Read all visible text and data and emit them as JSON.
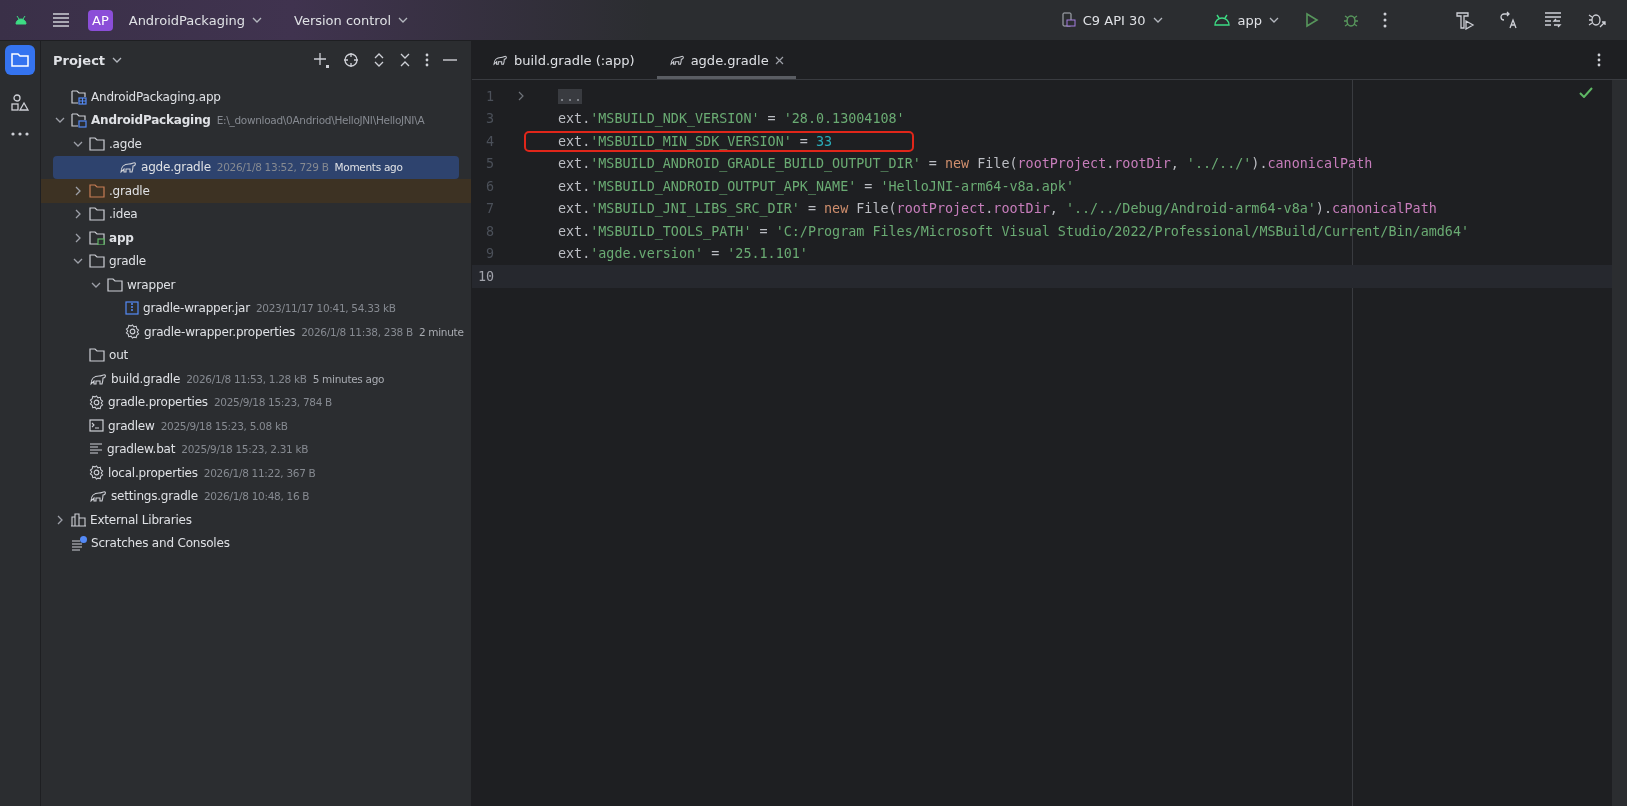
{
  "toolbar": {
    "project_badge": "AP",
    "project_name": "AndroidPackaging",
    "vcs": "Version control",
    "device": "C9 API 30",
    "run_config": "app"
  },
  "project_panel": {
    "title": "Project",
    "tree": [
      {
        "name": "AndroidPackaging.app",
        "kind": "module-app"
      },
      {
        "name": "AndroidPackaging",
        "bold": true,
        "meta": "E:\\_download\\0Andriod\\HelloJNI\\HelloJNI\\A",
        "kind": "module",
        "expanded": true,
        "children": [
          {
            "name": ".agde",
            "kind": "folder",
            "expanded": true,
            "children": [
              {
                "name": "agde.gradle",
                "kind": "gradle",
                "meta": "2026/1/8 13:52, 729 B",
                "note": "Moments ago",
                "selected": true
              }
            ]
          },
          {
            "name": ".gradle",
            "kind": "folder-excluded",
            "expanded": false,
            "highlighted": true
          },
          {
            "name": ".idea",
            "kind": "folder",
            "expanded": false
          },
          {
            "name": "app",
            "kind": "folder-module",
            "bold": true,
            "expanded": false
          },
          {
            "name": "gradle",
            "kind": "folder",
            "expanded": true,
            "children": [
              {
                "name": "wrapper",
                "kind": "folder",
                "expanded": true,
                "children": [
                  {
                    "name": "gradle-wrapper.jar",
                    "kind": "jar",
                    "meta": "2023/11/17 10:41, 54.33 kB"
                  },
                  {
                    "name": "gradle-wrapper.properties",
                    "kind": "settings",
                    "meta": "2026/1/8 11:38, 238 B",
                    "note": "2 minute"
                  }
                ]
              }
            ]
          },
          {
            "name": "out",
            "kind": "folder"
          },
          {
            "name": "build.gradle",
            "kind": "gradle",
            "meta": "2026/1/8 11:53, 1.28 kB",
            "note": "5 minutes ago"
          },
          {
            "name": "gradle.properties",
            "kind": "settings",
            "meta": "2025/9/18 15:23, 784 B"
          },
          {
            "name": "gradlew",
            "kind": "terminal",
            "meta": "2025/9/18 15:23, 5.08 kB"
          },
          {
            "name": "gradlew.bat",
            "kind": "text",
            "meta": "2025/9/18 15:23, 2.31 kB"
          },
          {
            "name": "local.properties",
            "kind": "settings",
            "meta": "2026/1/8 11:22, 367 B"
          },
          {
            "name": "settings.gradle",
            "kind": "gradle",
            "meta": "2026/1/8 10:48, 16 B"
          }
        ]
      },
      {
        "name": "External Libraries",
        "kind": "libraries",
        "expanded": false
      },
      {
        "name": "Scratches and Consoles",
        "kind": "scratches"
      }
    ]
  },
  "editor": {
    "tabs": [
      {
        "label": "build.gradle (:app)",
        "selected": false
      },
      {
        "label": "agde.gradle",
        "selected": true
      }
    ],
    "lines": [
      {
        "number": "1",
        "folded": true,
        "tokens": [
          {
            "kind": "fold",
            "text": "..."
          }
        ]
      },
      {
        "number": "3",
        "tokens": [
          {
            "kind": "plain",
            "text": "ext."
          },
          {
            "kind": "string",
            "text": "'MSBUILD_NDK_VERSION'"
          },
          {
            "kind": "plain",
            "text": " = "
          },
          {
            "kind": "string",
            "text": "'28.0.13004108'"
          }
        ]
      },
      {
        "number": "4",
        "boxed": true,
        "tokens": [
          {
            "kind": "plain",
            "text": "ext."
          },
          {
            "kind": "string",
            "text": "'MSBUILD_MIN_SDK_VERSION'"
          },
          {
            "kind": "plain",
            "text": " = "
          },
          {
            "kind": "number",
            "text": "33"
          }
        ]
      },
      {
        "number": "5",
        "tokens": [
          {
            "kind": "plain",
            "text": "ext."
          },
          {
            "kind": "string",
            "text": "'MSBUILD_ANDROID_GRADLE_BUILD_OUTPUT_DIR'"
          },
          {
            "kind": "plain",
            "text": " = "
          },
          {
            "kind": "keyword",
            "text": "new"
          },
          {
            "kind": "plain",
            "text": " File("
          },
          {
            "kind": "field",
            "text": "rootProject"
          },
          {
            "kind": "plain",
            "text": "."
          },
          {
            "kind": "field",
            "text": "rootDir"
          },
          {
            "kind": "plain",
            "text": ", "
          },
          {
            "kind": "string",
            "text": "'../../'"
          },
          {
            "kind": "plain",
            "text": ")."
          },
          {
            "kind": "field",
            "text": "canonicalPath"
          }
        ]
      },
      {
        "number": "6",
        "tokens": [
          {
            "kind": "plain",
            "text": "ext."
          },
          {
            "kind": "string",
            "text": "'MSBUILD_ANDROID_OUTPUT_APK_NAME'"
          },
          {
            "kind": "plain",
            "text": " = "
          },
          {
            "kind": "string",
            "text": "'HelloJNI-arm64-v8a.apk'"
          }
        ]
      },
      {
        "number": "7",
        "tokens": [
          {
            "kind": "plain",
            "text": "ext."
          },
          {
            "kind": "string",
            "text": "'MSBUILD_JNI_LIBS_SRC_DIR'"
          },
          {
            "kind": "plain",
            "text": " = "
          },
          {
            "kind": "keyword",
            "text": "new"
          },
          {
            "kind": "plain",
            "text": " File("
          },
          {
            "kind": "field",
            "text": "rootProject"
          },
          {
            "kind": "plain",
            "text": "."
          },
          {
            "kind": "field",
            "text": "rootDir"
          },
          {
            "kind": "plain",
            "text": ", "
          },
          {
            "kind": "string",
            "text": "'../../Debug/Android-arm64-v8a'"
          },
          {
            "kind": "plain",
            "text": ")."
          },
          {
            "kind": "field",
            "text": "canonicalPath"
          }
        ]
      },
      {
        "number": "8",
        "tokens": [
          {
            "kind": "plain",
            "text": "ext."
          },
          {
            "kind": "string",
            "text": "'MSBUILD_TOOLS_PATH'"
          },
          {
            "kind": "plain",
            "text": " = "
          },
          {
            "kind": "string",
            "text": "'C:/Program Files/Microsoft Visual Studio/2022/Professional/MSBuild/Current/Bin/amd64'"
          }
        ]
      },
      {
        "number": "9",
        "tokens": [
          {
            "kind": "plain",
            "text": "ext."
          },
          {
            "kind": "string",
            "text": "'agde.version'"
          },
          {
            "kind": "plain",
            "text": " = "
          },
          {
            "kind": "string",
            "text": "'25.1.101'"
          }
        ]
      },
      {
        "number": "10",
        "current": true
      }
    ]
  }
}
